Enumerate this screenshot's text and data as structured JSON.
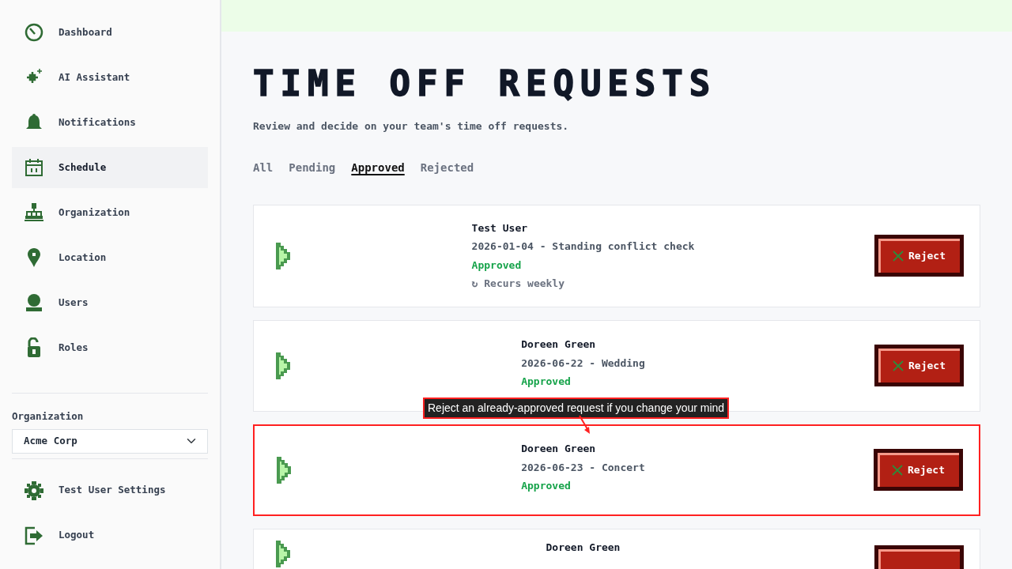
{
  "sidebar": {
    "items": [
      {
        "label": "Dashboard",
        "kind": "gauge",
        "selected": false
      },
      {
        "label": "AI Assistant",
        "kind": "sparkle",
        "selected": false
      },
      {
        "label": "Notifications",
        "kind": "bell",
        "selected": false
      },
      {
        "label": "Schedule",
        "kind": "calendar",
        "selected": true
      },
      {
        "label": "Organization",
        "kind": "org",
        "selected": false
      },
      {
        "label": "Location",
        "kind": "pin",
        "selected": false
      },
      {
        "label": "Users",
        "kind": "user",
        "selected": false
      },
      {
        "label": "Roles",
        "kind": "lock",
        "selected": false
      }
    ],
    "organization": {
      "label": "Organization",
      "value": "Acme Corp"
    },
    "footer_items": [
      {
        "label": "Test User Settings",
        "kind": "gear"
      },
      {
        "label": "Logout",
        "kind": "logout"
      }
    ]
  },
  "page": {
    "title": "TIME OFF REQUESTS",
    "subtitle": "Review and decide on your team's time off requests."
  },
  "tabs": [
    {
      "label": "All",
      "selected": false
    },
    {
      "label": "Pending",
      "selected": false
    },
    {
      "label": "Approved",
      "selected": true
    },
    {
      "label": "Rejected",
      "selected": false
    }
  ],
  "requests": [
    {
      "name": "Test User",
      "detail": "2026-01-04 - Standing conflict check",
      "status": "Approved",
      "recurrence": "↻ Recurs weekly",
      "button": "Reject",
      "highlighted": false
    },
    {
      "name": "Doreen Green",
      "detail": "2026-06-22 - Wedding",
      "status": "Approved",
      "button": "Reject",
      "highlighted": false
    },
    {
      "name": "Doreen Green",
      "detail": "2026-06-23 - Concert",
      "status": "Approved",
      "button": "Reject",
      "highlighted": true
    },
    {
      "name": "Doreen Green",
      "highlighted": false
    }
  ],
  "annotation": {
    "text": "Reject an already-approved request if you change your mind"
  }
}
